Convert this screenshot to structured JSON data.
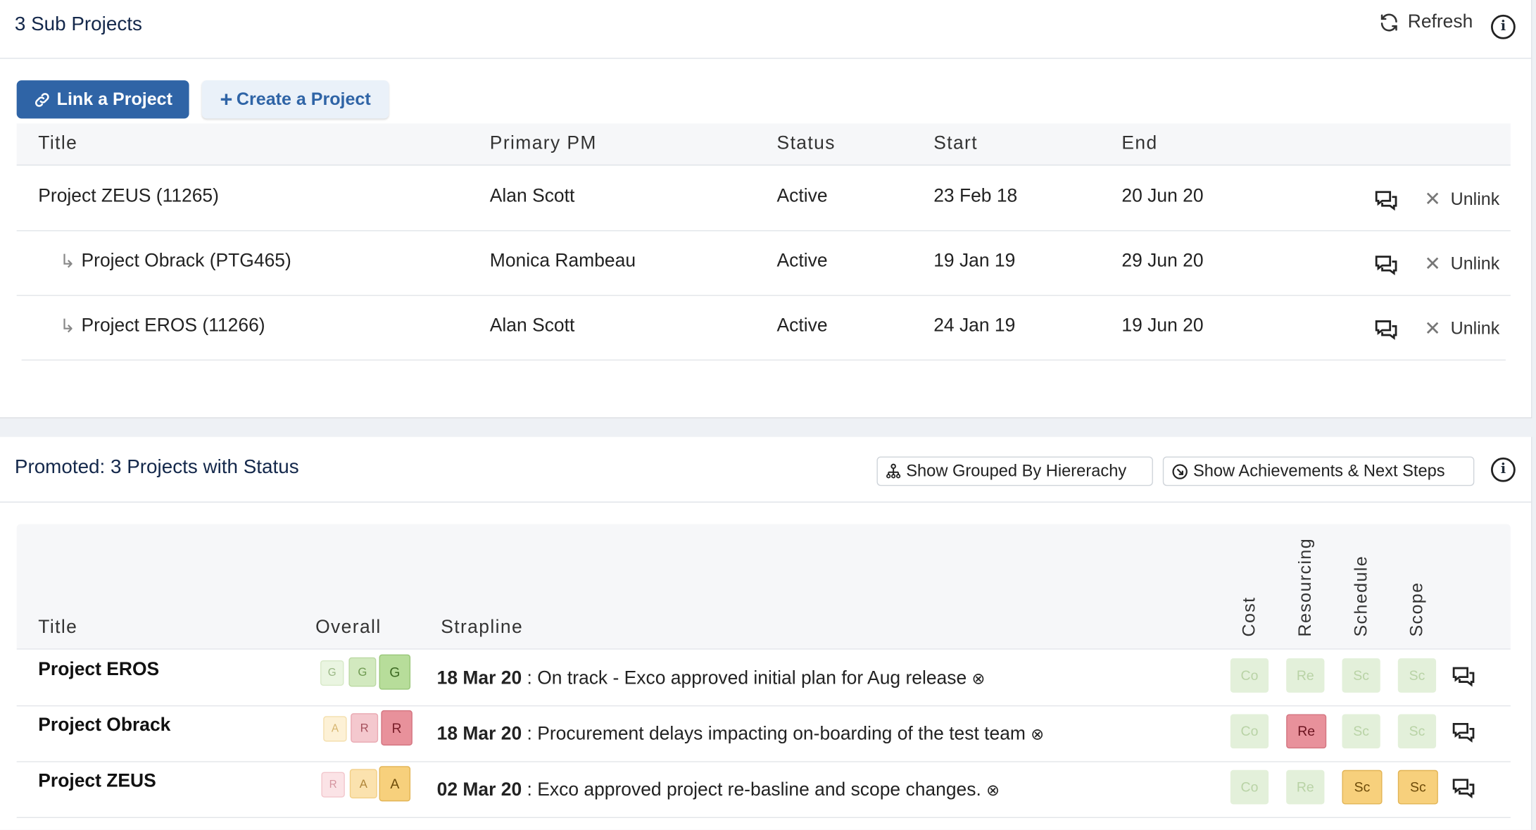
{
  "subprojects": {
    "title": "3 Sub Projects",
    "refresh_label": "Refresh",
    "link_label": "Link a Project",
    "create_label": "Create a Project",
    "columns": [
      "Title",
      "Primary PM",
      "Status",
      "Start",
      "End"
    ],
    "unlink_label": "Unlink",
    "rows": [
      {
        "title": "Project ZEUS (11265)",
        "pm": "Alan Scott",
        "status": "Active",
        "start": "23 Feb 18",
        "end": "20 Jun 20"
      },
      {
        "title": "Project Obrack (PTG465)",
        "pm": "Monica Rambeau",
        "status": "Active",
        "start": "19 Jan 19",
        "end": "29 Jun 20"
      },
      {
        "title": "Project EROS (11266)",
        "pm": "Alan Scott",
        "status": "Active",
        "start": "24 Jan 19",
        "end": "19 Jun 20"
      }
    ]
  },
  "promoted": {
    "title": "Promoted: 3 Projects with Status",
    "grouped_label": "Show Grouped By Hiererachy",
    "achievements_label": "Show Achievements & Next Steps",
    "columns": {
      "title": "Title",
      "overall": "Overall",
      "strapline": "Strapline",
      "cost": "Cost",
      "resourcing": "Resourcing",
      "schedule": "Schedule",
      "scope": "Scope"
    },
    "rows": [
      {
        "title": "Project EROS",
        "overall": [
          "G",
          "G",
          "G"
        ],
        "date": "18 Mar 20",
        "text": ": On track - Exco approved initial plan for Aug release",
        "dims": [
          "Co",
          "Re",
          "Sc",
          "Sc"
        ]
      },
      {
        "title": "Project Obrack",
        "overall": [
          "A",
          "R",
          "R"
        ],
        "date": "18 Mar 20",
        "text": ": Procurement delays impacting on-boarding of the test team",
        "dims": [
          "Co",
          "Re",
          "Sc",
          "Sc"
        ]
      },
      {
        "title": "Project ZEUS",
        "overall": [
          "R",
          "A",
          "A"
        ],
        "date": "02 Mar 20",
        "text": ": Exco approved project re-basline and scope changes.",
        "dims": [
          "Co",
          "Re",
          "Sc",
          "Sc"
        ]
      }
    ]
  },
  "colors": {
    "primary": "#2f64a6",
    "green": "#b7dd9a",
    "amber": "#f7d07c",
    "red": "#e8919b",
    "pale_green": "#e3f0da"
  }
}
